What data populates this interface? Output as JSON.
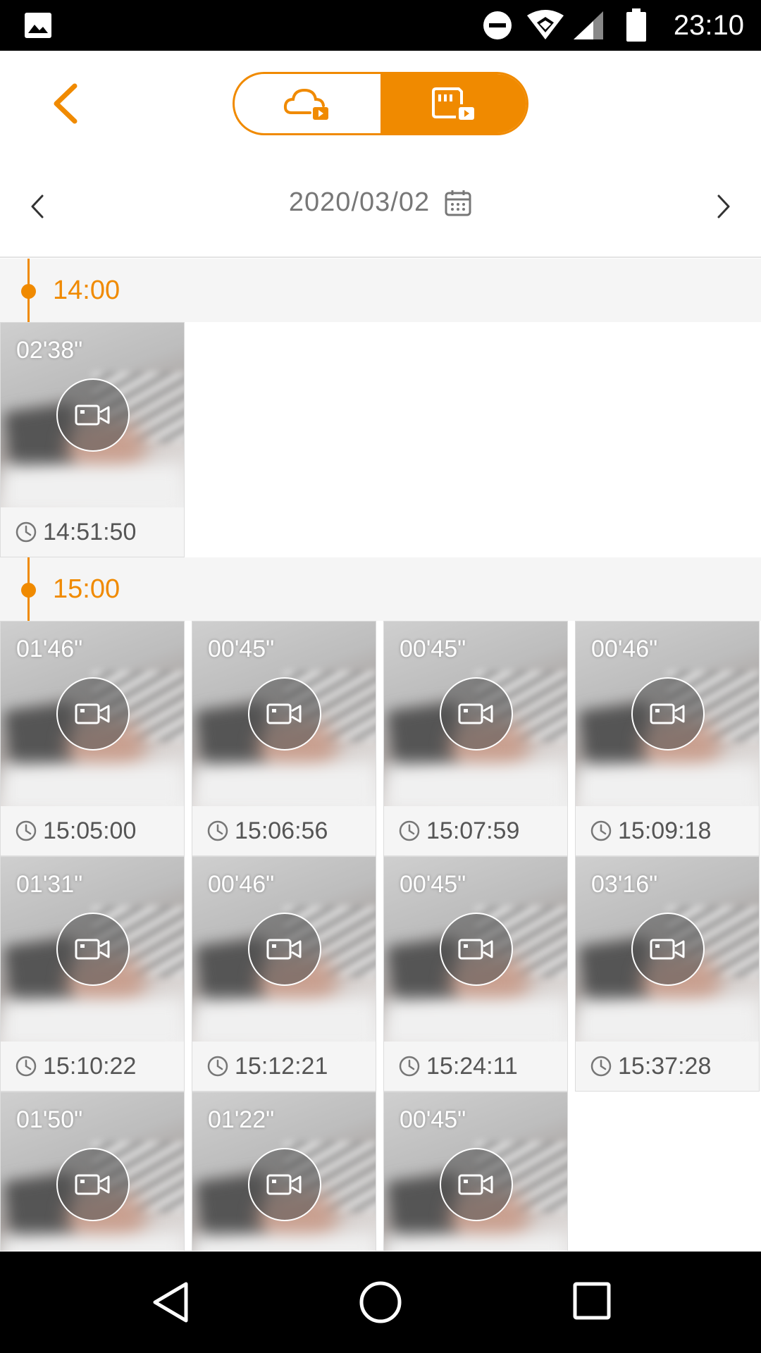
{
  "status_bar": {
    "time": "23:10",
    "icons": [
      "gallery-icon",
      "do-not-disturb-icon",
      "wifi-icon",
      "signal-icon",
      "battery-icon"
    ]
  },
  "header": {
    "back_icon": "chevron-left-icon",
    "modes": [
      {
        "icon": "cloud-playback-icon",
        "active": false
      },
      {
        "icon": "sd-card-playback-icon",
        "active": true
      }
    ]
  },
  "date_nav": {
    "date": "2020/03/02",
    "icons": [
      "chevron-left-icon",
      "calendar-icon",
      "chevron-right-icon"
    ]
  },
  "groups": [
    {
      "hour": "14:00",
      "clips": [
        {
          "duration": "02'38\"",
          "time": "14:51:50"
        }
      ]
    },
    {
      "hour": "15:00",
      "clips": [
        {
          "duration": "01'46\"",
          "time": "15:05:00"
        },
        {
          "duration": "00'45\"",
          "time": "15:06:56"
        },
        {
          "duration": "00'45\"",
          "time": "15:07:59"
        },
        {
          "duration": "00'46\"",
          "time": "15:09:18"
        },
        {
          "duration": "01'31\"",
          "time": "15:10:22"
        },
        {
          "duration": "00'46\"",
          "time": "15:12:21"
        },
        {
          "duration": "00'45\"",
          "time": "15:24:11"
        },
        {
          "duration": "03'16\"",
          "time": "15:37:28"
        },
        {
          "duration": "01'50\"",
          "time": ""
        },
        {
          "duration": "01'22\"",
          "time": ""
        },
        {
          "duration": "00'45\"",
          "time": ""
        }
      ]
    }
  ],
  "colors": {
    "accent": "#f08a00",
    "section_bg": "#f5f5f5",
    "text_muted": "#777777"
  },
  "nav_bar": {
    "icons": [
      "back-triangle-icon",
      "home-circle-icon",
      "recents-square-icon"
    ]
  }
}
